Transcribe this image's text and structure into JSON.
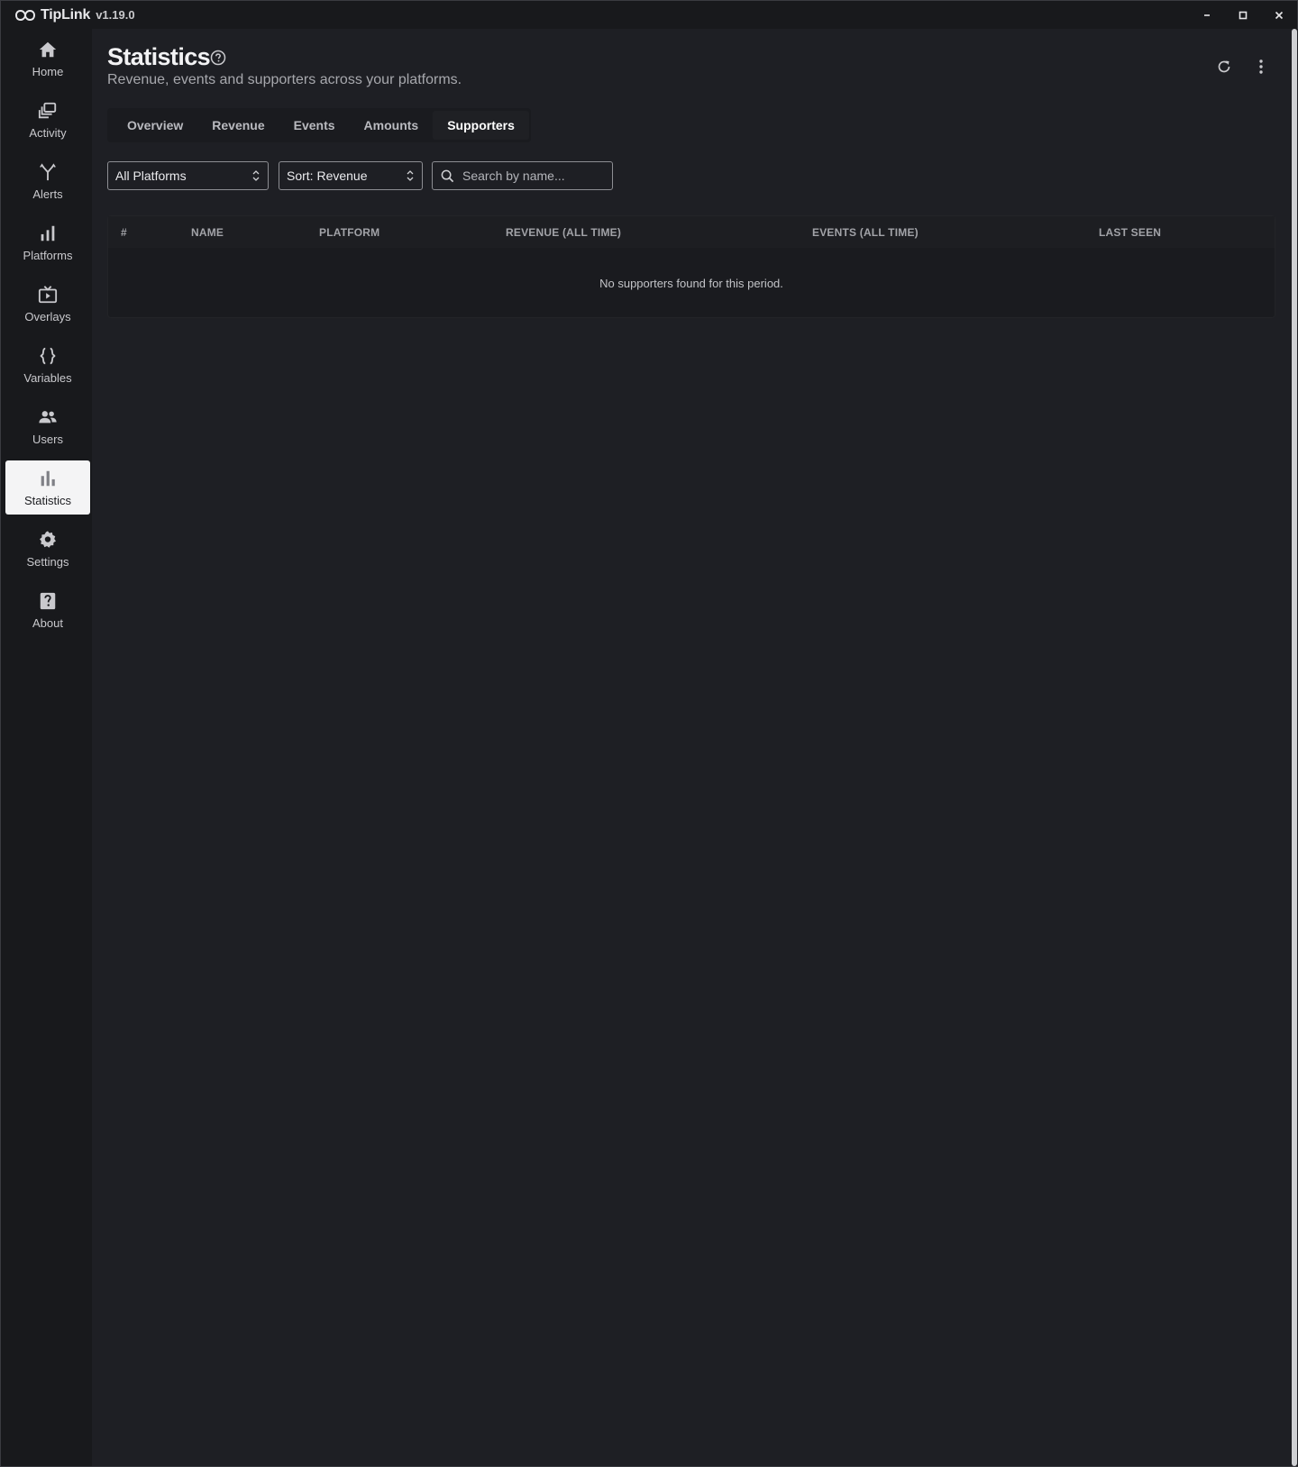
{
  "app": {
    "name": "TipLink",
    "version": "v1.19.0"
  },
  "sidebar": {
    "items": [
      {
        "label": "Home",
        "icon": "home-icon"
      },
      {
        "label": "Activity",
        "icon": "activity-icon"
      },
      {
        "label": "Alerts",
        "icon": "alerts-icon"
      },
      {
        "label": "Platforms",
        "icon": "platforms-icon"
      },
      {
        "label": "Overlays",
        "icon": "overlays-icon"
      },
      {
        "label": "Variables",
        "icon": "variables-icon"
      },
      {
        "label": "Users",
        "icon": "users-icon"
      },
      {
        "label": "Statistics",
        "icon": "statistics-icon",
        "active": true
      },
      {
        "label": "Settings",
        "icon": "settings-icon"
      },
      {
        "label": "About",
        "icon": "about-icon"
      }
    ]
  },
  "header": {
    "title": "Statistics",
    "subtitle": "Revenue, events and supporters across your platforms."
  },
  "tabs": [
    {
      "label": "Overview"
    },
    {
      "label": "Revenue"
    },
    {
      "label": "Events"
    },
    {
      "label": "Amounts"
    },
    {
      "label": "Supporters",
      "active": true
    }
  ],
  "filters": {
    "platform": "All Platforms",
    "sort": "Sort: Revenue",
    "search_placeholder": "Search by name..."
  },
  "table": {
    "columns": [
      "#",
      "NAME",
      "PLATFORM",
      "REVENUE (ALL TIME)",
      "EVENTS (ALL TIME)",
      "LAST SEEN"
    ],
    "empty_message": "No supporters found for this period."
  },
  "colors": {
    "background": "#1e1f24",
    "sidebar": "#18191c",
    "active_nav": "#f4f4f5"
  }
}
